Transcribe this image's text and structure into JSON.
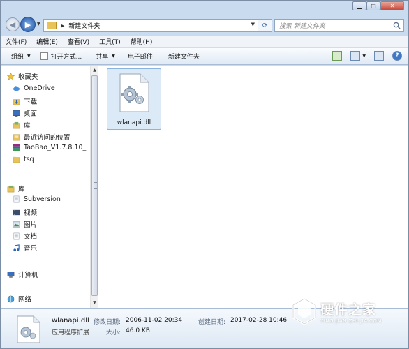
{
  "address": {
    "crumb": "新建文件夹",
    "search_placeholder": "搜索 新建文件夹"
  },
  "menu": [
    "文件(F)",
    "编辑(E)",
    "查看(V)",
    "工具(T)",
    "帮助(H)"
  ],
  "commands": {
    "organize": "组织",
    "open_with": "打开方式...",
    "share": "共享",
    "email": "电子邮件",
    "new_folder": "新建文件夹"
  },
  "sidebar": {
    "favorites": {
      "label": "收藏夹",
      "items": [
        "OneDrive",
        "下载",
        "桌面",
        "库",
        "最近访问的位置",
        "TaoBao_V1.7.8.10_",
        "tsq"
      ]
    },
    "libraries": {
      "label": "库",
      "items": [
        "Subversion",
        "视频",
        "图片",
        "文档",
        "音乐"
      ]
    },
    "computer": "计算机",
    "network": "网络"
  },
  "content": {
    "file_name": "wlanapi.dll"
  },
  "details": {
    "name": "wlanapi.dll",
    "type": "应用程序扩展",
    "modified_label": "修改日期:",
    "modified_value": "2006-11-02 20:34",
    "created_label": "创建日期:",
    "created_value": "2017-02-28 10:46",
    "size_label": "大小:",
    "size_value": "46.0 KB"
  },
  "watermark": {
    "title": "硬件之家",
    "subtitle": "YING JIAN ZHI JIA.COM"
  },
  "colors": {
    "accent": "#3e78c7",
    "selection": "#dceaf8",
    "frame": "#c9dbef"
  }
}
